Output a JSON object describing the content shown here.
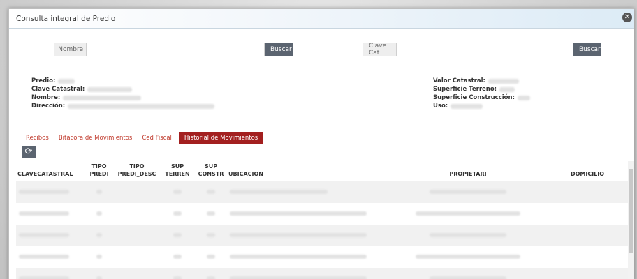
{
  "modal": {
    "title": "Consulta integral de Predio",
    "close_icon": "close-icon"
  },
  "search": {
    "nombre_label": "Nombre",
    "nombre_value": "",
    "nombre_button": "Buscar",
    "clave_label": "Clave Cat",
    "clave_value": "",
    "clave_button": "Buscar"
  },
  "info_left": {
    "predio": "Predio:",
    "clave_catastral": "Clave Catastral:",
    "nombre": "Nombre:",
    "direccion": "Dirección:"
  },
  "info_right": {
    "valor_catastral": "Valor Catastral:",
    "superficie_terreno": "Superficie Terreno:",
    "superficie_construccion": "Superficie Construcción:",
    "uso": "Uso:"
  },
  "tabs": [
    "Recibos",
    "Bitacora de Movimientos",
    "Ced Fiscal",
    "Historial de Movimientos"
  ],
  "active_tab": "Historial de Movimientos",
  "toolbar": {
    "refresh_icon": "refresh-icon",
    "refresh_glyph": "⟳"
  },
  "table": {
    "headers": [
      [
        "CLAVECATASTRAL"
      ],
      [
        "TIPO",
        "PREDI"
      ],
      [
        "TIPO",
        "PREDI_DESC"
      ],
      [
        "SUP",
        "TERREN"
      ],
      [
        "SUP",
        "CONSTR"
      ],
      [
        "UBICACION"
      ],
      [
        "PROPIETARI"
      ],
      [
        "DOMICILIO"
      ]
    ],
    "row_count": 5
  },
  "colors": {
    "accent": "#a31f1f",
    "tab_text": "#c0392b",
    "button": "#5b6470"
  }
}
